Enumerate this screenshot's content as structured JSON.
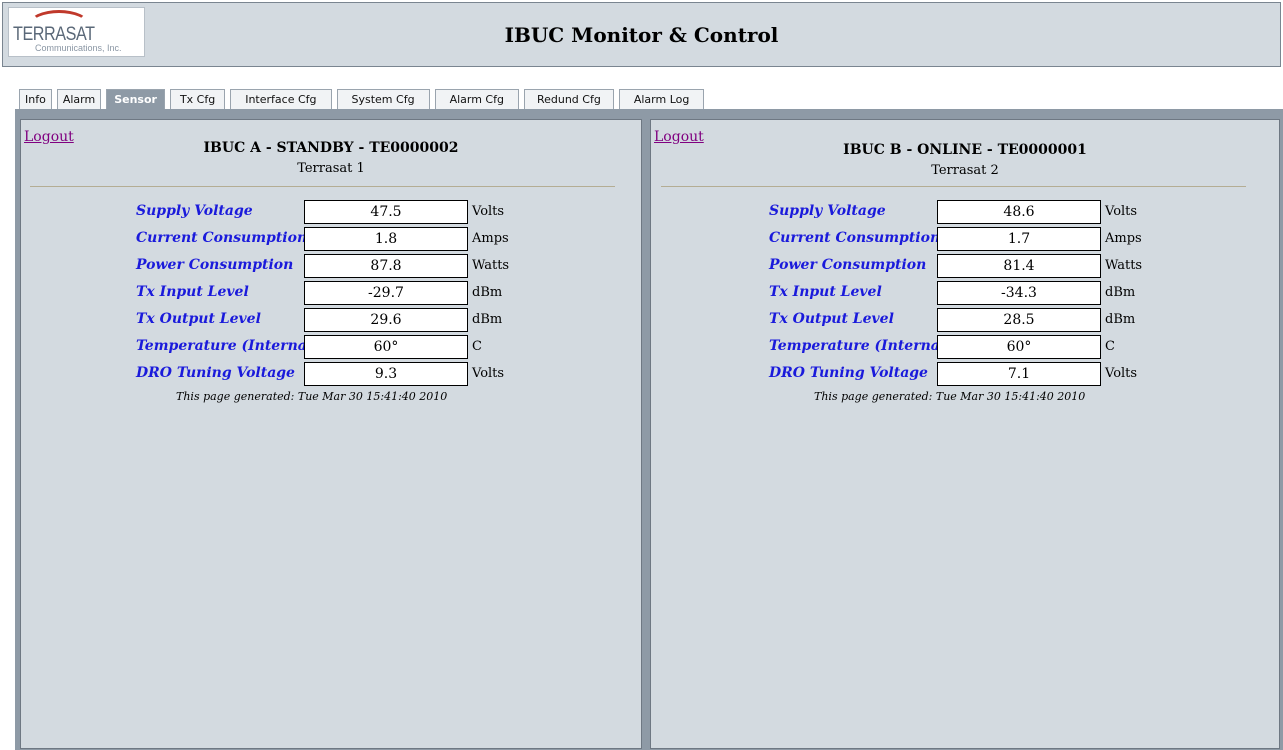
{
  "header": {
    "logo_text": "TERRASAT",
    "logo_sub": "Communications, Inc.",
    "title": "IBUC Monitor & Control"
  },
  "tabs": [
    {
      "label": "Info",
      "active": false
    },
    {
      "label": "Alarm",
      "active": false
    },
    {
      "label": "Sensor",
      "active": true
    },
    {
      "label": "Tx Cfg",
      "active": false
    },
    {
      "label": "Interface Cfg",
      "active": false
    },
    {
      "label": "System Cfg",
      "active": false
    },
    {
      "label": "Alarm Cfg",
      "active": false
    },
    {
      "label": "Redund Cfg",
      "active": false
    },
    {
      "label": "Alarm Log",
      "active": false
    }
  ],
  "units": [
    {
      "logout": "Logout",
      "title": "IBUC A - STANDBY - TE0000002",
      "name": "Terrasat 1",
      "sensors": [
        {
          "label": "Supply Voltage",
          "value": "47.5",
          "unit": "Volts"
        },
        {
          "label": "Current Consumption",
          "value": "1.8",
          "unit": "Amps"
        },
        {
          "label": "Power Consumption",
          "value": "87.8",
          "unit": "Watts"
        },
        {
          "label": "Tx Input Level",
          "value": "-29.7",
          "unit": "dBm"
        },
        {
          "label": "Tx Output Level",
          "value": "29.6",
          "unit": "dBm"
        },
        {
          "label": "Temperature (Internal)",
          "value": "60°",
          "unit": "C"
        },
        {
          "label": "DRO Tuning Voltage",
          "value": "9.3",
          "unit": "Volts"
        }
      ],
      "generated": "This page generated: Tue Mar 30 15:41:40 2010"
    },
    {
      "logout": "Logout",
      "title": "IBUC B - ONLINE - TE0000001",
      "name": "Terrasat 2",
      "sensors": [
        {
          "label": "Supply Voltage",
          "value": "48.6",
          "unit": "Volts"
        },
        {
          "label": "Current Consumption",
          "value": "1.7",
          "unit": "Amps"
        },
        {
          "label": "Power Consumption",
          "value": "81.4",
          "unit": "Watts"
        },
        {
          "label": "Tx Input Level",
          "value": "-34.3",
          "unit": "dBm"
        },
        {
          "label": "Tx Output Level",
          "value": "28.5",
          "unit": "dBm"
        },
        {
          "label": "Temperature (Internal)",
          "value": "60°",
          "unit": "C"
        },
        {
          "label": "DRO Tuning Voltage",
          "value": "7.1",
          "unit": "Volts"
        }
      ],
      "generated": "This page generated: Tue Mar 30 15:41:40 2010"
    }
  ]
}
